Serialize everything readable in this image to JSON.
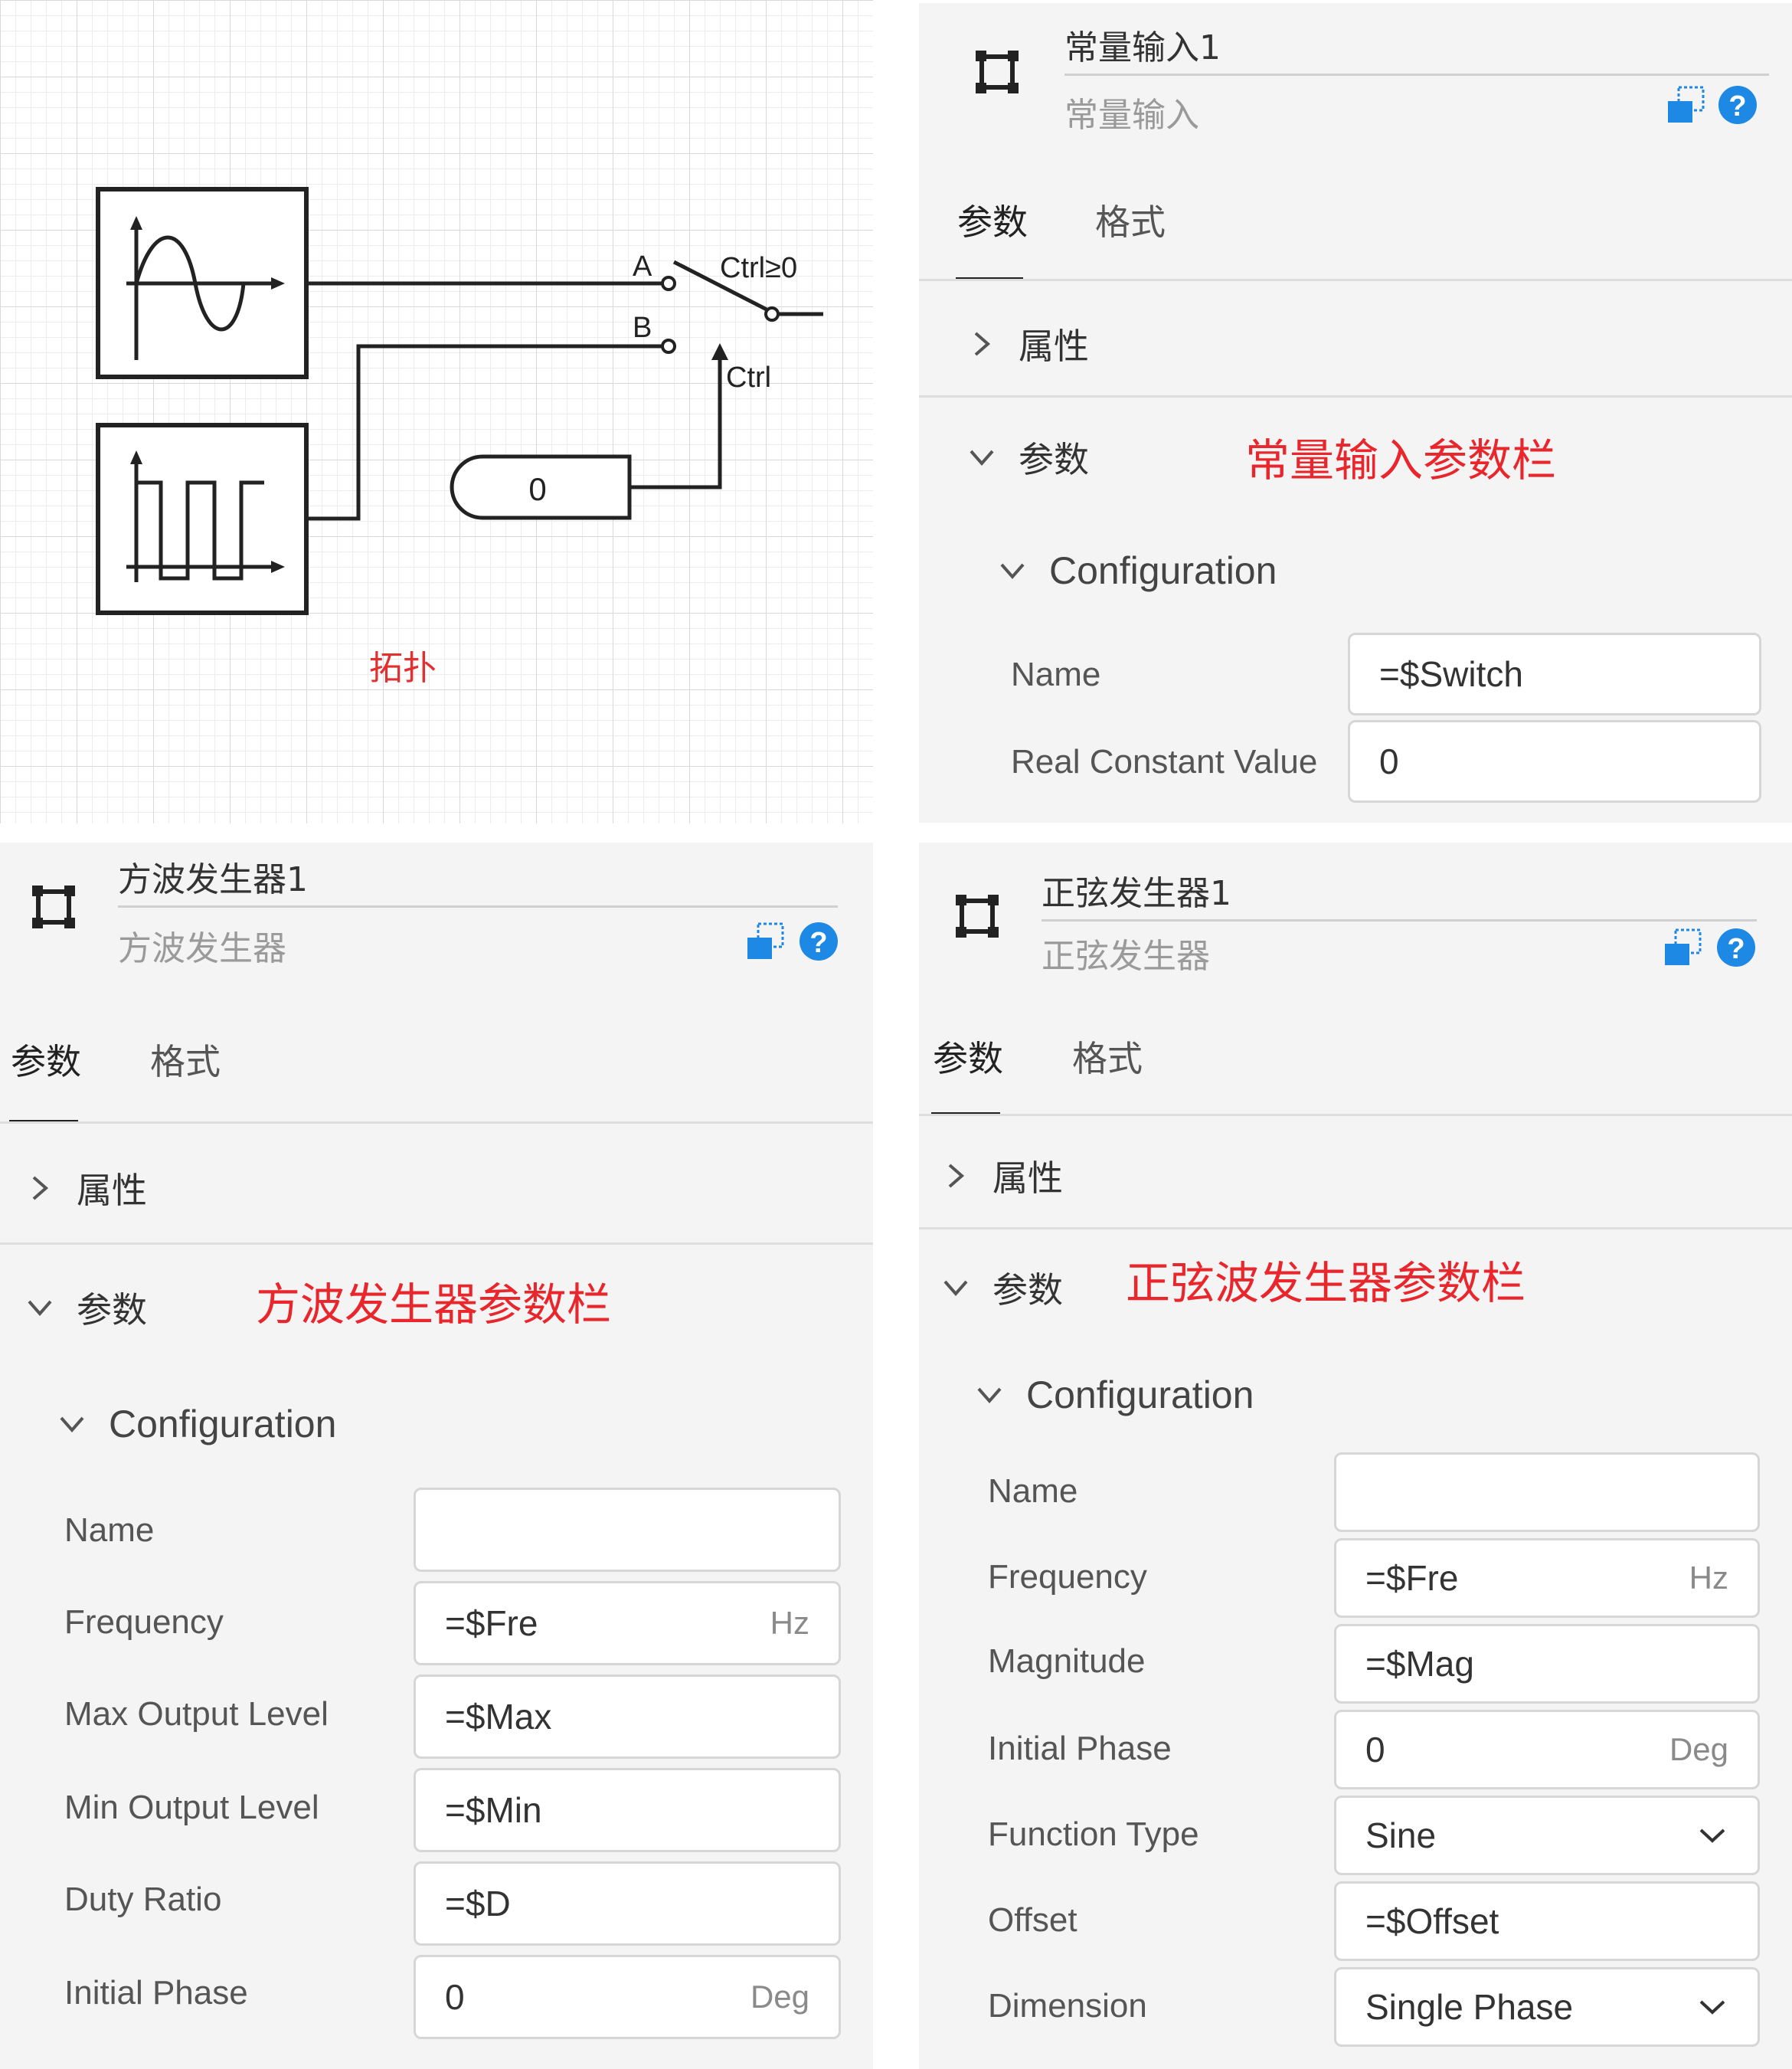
{
  "canvas": {
    "label": "拓扑",
    "switch_a": "A",
    "switch_b": "B",
    "switch_cond": "Ctrl≥0",
    "switch_ctrl": "Ctrl",
    "const_value": "0"
  },
  "const_panel": {
    "title": "常量输入1",
    "subtitle": "常量输入",
    "tabs": [
      "参数",
      "格式"
    ],
    "section_props": "属性",
    "section_params": "参数",
    "annotation": "常量输入参数栏",
    "config": "Configuration",
    "params": [
      {
        "label": "Name",
        "value": "=$Switch",
        "unit": ""
      },
      {
        "label": "Real Constant Value",
        "value": "0",
        "unit": ""
      }
    ]
  },
  "square_panel": {
    "title": "方波发生器1",
    "subtitle": "方波发生器",
    "tabs": [
      "参数",
      "格式"
    ],
    "section_props": "属性",
    "section_params": "参数",
    "annotation": "方波发生器参数栏",
    "config": "Configuration",
    "params": [
      {
        "label": "Name",
        "value": "",
        "unit": ""
      },
      {
        "label": "Frequency",
        "value": "=$Fre",
        "unit": "Hz"
      },
      {
        "label": "Max Output Level",
        "value": "=$Max",
        "unit": ""
      },
      {
        "label": "Min Output Level",
        "value": "=$Min",
        "unit": ""
      },
      {
        "label": "Duty Ratio",
        "value": "=$D",
        "unit": ""
      },
      {
        "label": "Initial Phase",
        "value": "0",
        "unit": "Deg"
      }
    ]
  },
  "sine_panel": {
    "title": "正弦发生器1",
    "subtitle": "正弦发生器",
    "tabs": [
      "参数",
      "格式"
    ],
    "section_props": "属性",
    "section_params": "参数",
    "annotation": "正弦波发生器参数栏",
    "config": "Configuration",
    "params": [
      {
        "label": "Name",
        "value": "",
        "unit": ""
      },
      {
        "label": "Frequency",
        "value": "=$Fre",
        "unit": "Hz"
      },
      {
        "label": "Magnitude",
        "value": "=$Mag",
        "unit": ""
      },
      {
        "label": "Initial Phase",
        "value": "0",
        "unit": "Deg"
      },
      {
        "label": "Function Type",
        "value": "Sine",
        "unit": ""
      },
      {
        "label": "Offset",
        "value": "=$Offset",
        "unit": ""
      },
      {
        "label": "Dimension",
        "value": "Single Phase",
        "unit": ""
      }
    ]
  },
  "colors": {
    "accent_blue": "#1e88e5",
    "annotation_red": "#e8262c"
  }
}
